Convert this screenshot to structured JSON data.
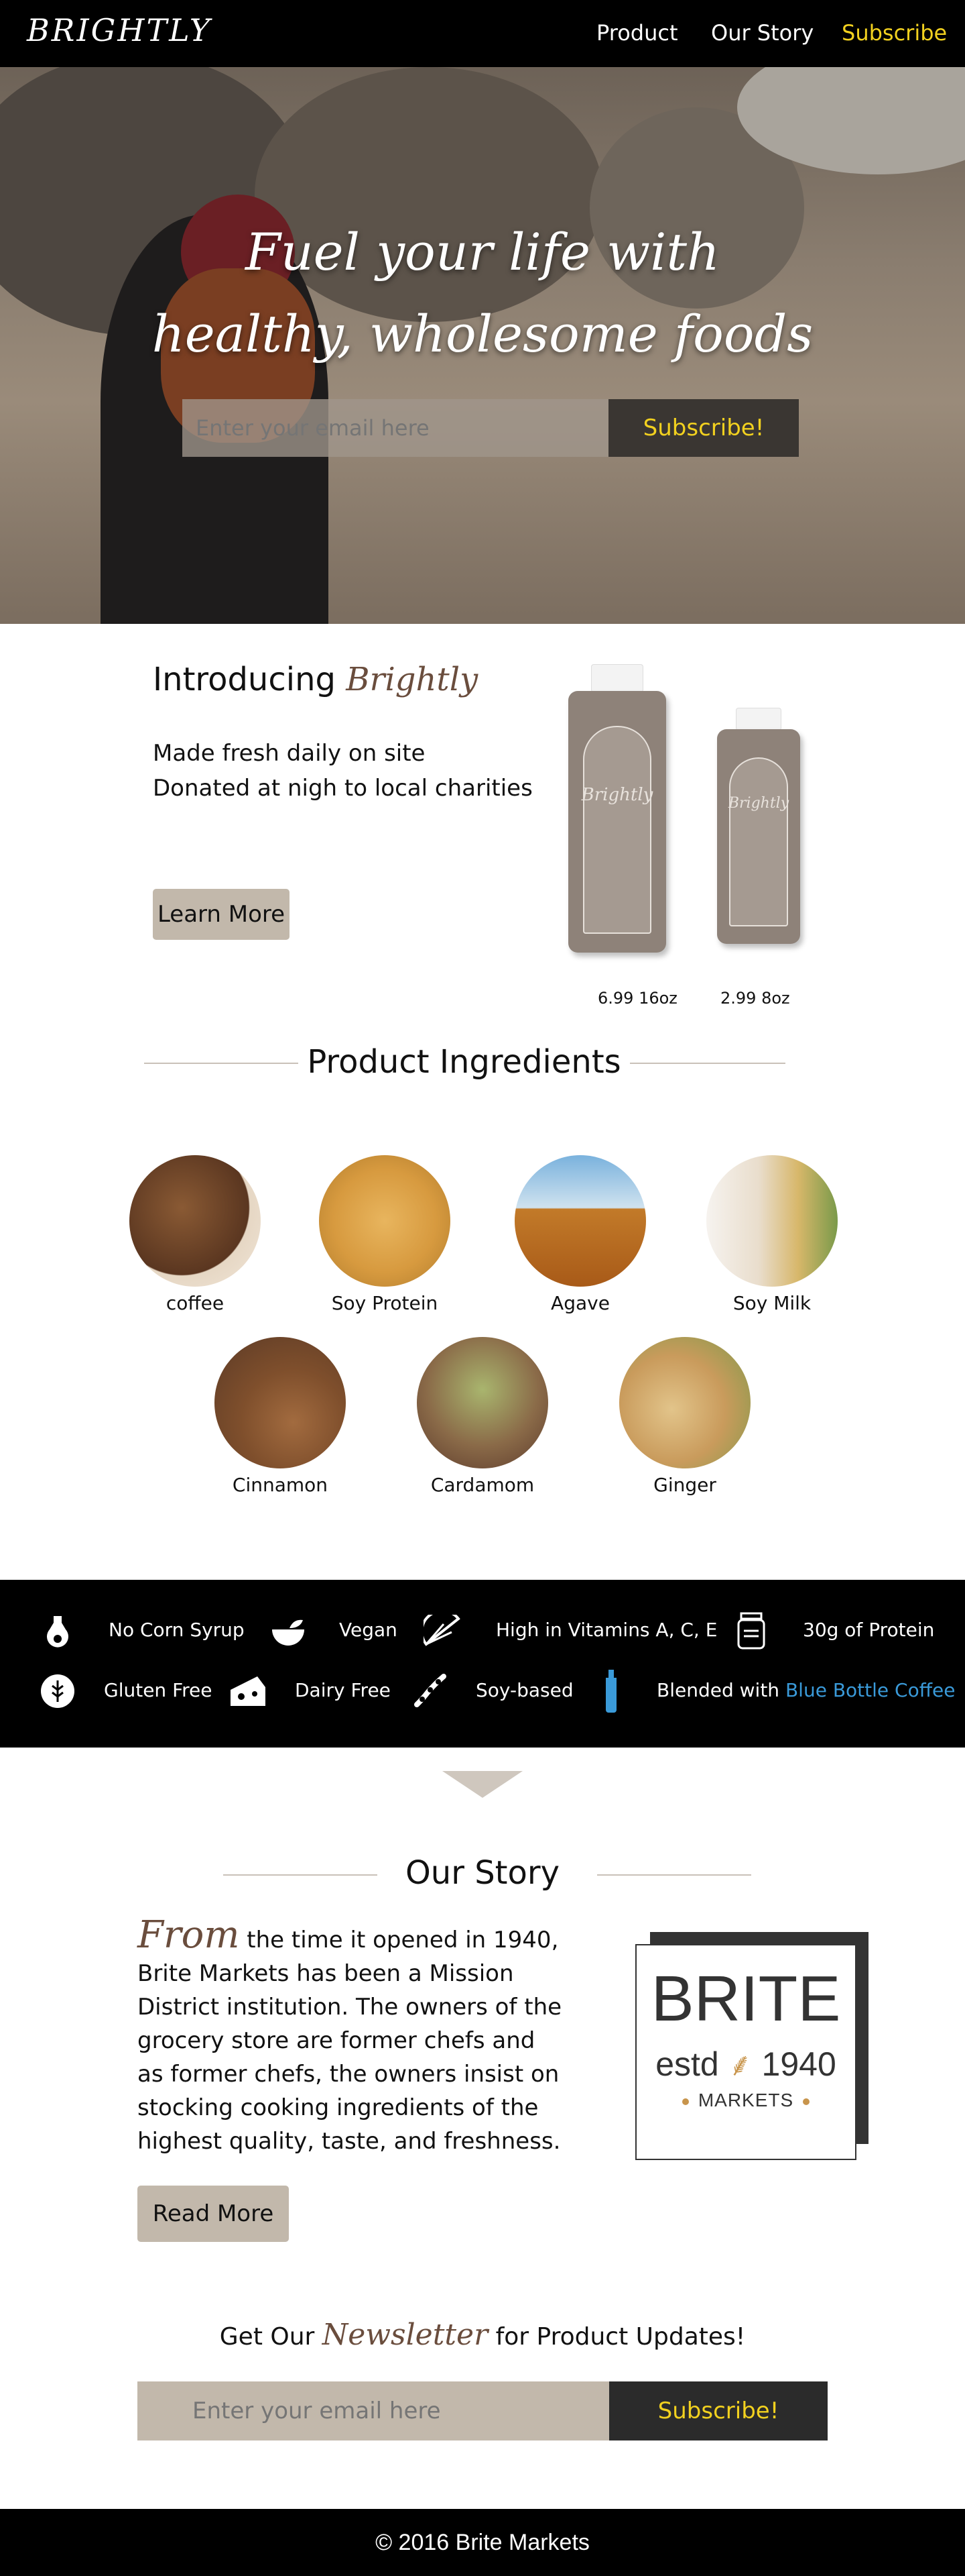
{
  "nav": {
    "logo": "BRIGHTLY",
    "links": [
      "Product",
      "Our Story",
      "Subscribe"
    ]
  },
  "hero": {
    "title_line1": "Fuel your life with",
    "title_line2": "healthy, wholesome foods",
    "email_placeholder": "Enter your email here",
    "subscribe_label": "Subscribe!"
  },
  "intro": {
    "title_prefix": "Introducing",
    "title_brand": "Brightly",
    "lines": [
      "Made fresh daily on site",
      "Donated at nigh to local charities"
    ],
    "learn_more": "Learn More",
    "bottle_brand": "Brightly",
    "prices": [
      "6.99 16oz",
      "2.99   8oz"
    ]
  },
  "ingredients": {
    "title": "Product Ingredients",
    "items": [
      "coffee",
      "Soy Protein",
      "Agave",
      "Soy Milk",
      "Cinnamon",
      "Cardamom",
      "Ginger"
    ]
  },
  "features": {
    "row1": [
      "No Corn Syrup",
      "Vegan",
      "High in Vitamins A, C, E",
      "30g of Protein"
    ],
    "row2": [
      "Gluten Free",
      "Dairy Free",
      "Soy-based"
    ],
    "blended_prefix": "Blended with",
    "blended_brand": "Blue Bottle Coffee",
    "accent_color": "#3a9ad9"
  },
  "story": {
    "title": "Our Story",
    "lead": "From",
    "body": "the time it opened in 1940, Brite Markets has been a Mission District institution. The owners of the grocery store are former chefs and as former chefs, the owners insist on stocking cooking ingredients of the highest quality, taste, and freshness.",
    "read_more": "Read More",
    "badge_big": "BRITE",
    "badge_estd": "estd",
    "badge_year": "1940",
    "badge_markets": "MARKETS"
  },
  "newsletter": {
    "prefix": "Get Our",
    "script": "Newsletter",
    "suffix": "for Product Updates!",
    "email_placeholder": "Enter your email here",
    "subscribe_label": "Subscribe!"
  },
  "footer": {
    "text": "© 2016 Brite Markets"
  },
  "colors": {
    "accent_yellow": "#f2d11f",
    "brand_brown": "#6a4d3d",
    "tan": "#c2b8ab"
  }
}
